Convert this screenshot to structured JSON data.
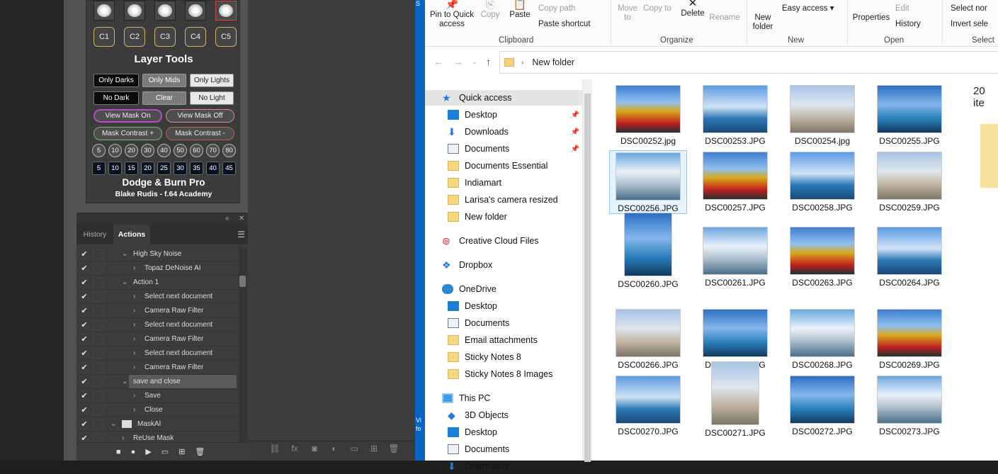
{
  "photoshop": {
    "swatches": [
      "brush-1",
      "brush-2",
      "brush-3",
      "brush-4",
      "brush-5"
    ],
    "channel_buttons": [
      "C1",
      "C2",
      "C3",
      "C4",
      "C5"
    ],
    "layer_tools_title": "Layer Tools",
    "row1": [
      "Only Darks",
      "Only Mids",
      "Only Lights"
    ],
    "row2": [
      "No Dark",
      "Clear",
      "No Light"
    ],
    "row3": [
      "View Mask On",
      "View Mask Off"
    ],
    "row4": [
      "Mask Contrast +",
      "Mask Contrast -"
    ],
    "num_row_1": [
      "5",
      "10",
      "20",
      "30",
      "40",
      "50",
      "60",
      "70",
      "80"
    ],
    "num_row_2": [
      "5",
      "10",
      "15",
      "20",
      "25",
      "30",
      "35",
      "40",
      "45"
    ],
    "panel_title": "Dodge & Burn Pro",
    "panel_subtitle": "Blake Rudis - f.64 Academy",
    "tabs": [
      "History",
      "Actions"
    ],
    "actions": [
      {
        "label": "High Sky Noise",
        "level": 1,
        "open": true
      },
      {
        "label": "Topaz DeNoise AI",
        "level": 2,
        "open": false
      },
      {
        "label": "Action 1",
        "level": 1,
        "open": true
      },
      {
        "label": "Select next document",
        "level": 2,
        "open": false
      },
      {
        "label": "Camera Raw Filter",
        "level": 2,
        "open": false
      },
      {
        "label": "Select next document",
        "level": 2,
        "open": false
      },
      {
        "label": "Camera Raw Filter",
        "level": 2,
        "open": false
      },
      {
        "label": "Select next document",
        "level": 2,
        "open": false
      },
      {
        "label": "Camera Raw Filter",
        "level": 2,
        "open": false
      },
      {
        "label": "save and close",
        "level": 1,
        "open": true,
        "highlight": true
      },
      {
        "label": "Save",
        "level": 2,
        "open": false
      },
      {
        "label": "Close",
        "level": 2,
        "open": false
      },
      {
        "label": "MaskAI",
        "level": 0,
        "open": true,
        "folder": true
      },
      {
        "label": "ReUse Mask",
        "level": 1,
        "open": false
      }
    ]
  },
  "explorer": {
    "ribbon": {
      "pin_label": "Pin to Quick access",
      "copy": "Copy",
      "paste": "Paste",
      "copy_path": "Copy path",
      "paste_shortcut": "Paste shortcut",
      "move_to": "Move to",
      "copy_to": "Copy to",
      "delete": "Delete",
      "rename": "Rename",
      "new_folder": "New folder",
      "easy_access": "Easy access",
      "properties": "Properties",
      "edit": "Edit",
      "history": "History",
      "select_none": "Select nor",
      "invert_selection": "Invert sele",
      "groups": [
        "Clipboard",
        "Organize",
        "New",
        "Open",
        "Select"
      ]
    },
    "address": "New folder",
    "nav": [
      {
        "label": "Quick access",
        "icon": "star-icon",
        "indent": 0,
        "selected": true
      },
      {
        "label": "Desktop",
        "icon": "desktop-icon",
        "indent": 1,
        "pinned": true
      },
      {
        "label": "Downloads",
        "icon": "downloads-icon",
        "indent": 1,
        "pinned": true
      },
      {
        "label": "Documents",
        "icon": "documents-icon",
        "indent": 1,
        "pinned": true
      },
      {
        "label": "Documents Essential",
        "icon": "folder-icon",
        "indent": 1
      },
      {
        "label": "Indiamart",
        "icon": "folder-icon",
        "indent": 1
      },
      {
        "label": "Larisa's camera resized",
        "icon": "folder-icon",
        "indent": 1
      },
      {
        "label": "New folder",
        "icon": "folder-icon",
        "indent": 1
      },
      {
        "label": "Creative Cloud Files",
        "icon": "creative-cloud-icon",
        "indent": 0,
        "gap": true
      },
      {
        "label": "Dropbox",
        "icon": "dropbox-icon",
        "indent": 0,
        "gap": true
      },
      {
        "label": "OneDrive",
        "icon": "onedrive-icon",
        "indent": 0,
        "gap": true
      },
      {
        "label": "Desktop",
        "icon": "desktop-icon",
        "indent": 1
      },
      {
        "label": "Documents",
        "icon": "documents-icon",
        "indent": 1
      },
      {
        "label": "Email attachments",
        "icon": "folder-icon",
        "indent": 1
      },
      {
        "label": "Sticky Notes 8",
        "icon": "folder-icon",
        "indent": 1
      },
      {
        "label": "Sticky Notes 8 Images",
        "icon": "folder-icon",
        "indent": 1
      },
      {
        "label": "This PC",
        "icon": "pc-icon",
        "indent": 0,
        "gap": true
      },
      {
        "label": "3D Objects",
        "icon": "3d-objects-icon",
        "indent": 1
      },
      {
        "label": "Desktop",
        "icon": "desktop-icon",
        "indent": 1
      },
      {
        "label": "Documents",
        "icon": "documents-icon",
        "indent": 1
      },
      {
        "label": "Downloads",
        "icon": "downloads-icon",
        "indent": 1
      }
    ],
    "item_count": "20 ite",
    "files": [
      "DSC00252.jpg",
      "DSC00253.JPG",
      "DSC00254.jpg",
      "DSC00255.JPG",
      "DSC00256.JPG",
      "DSC00257.JPG",
      "DSC00258.JPG",
      "DSC00259.JPG",
      "DSC00260.JPG",
      "DSC00261.JPG",
      "DSC00263.JPG",
      "DSC00264.JPG",
      "DSC00266.JPG",
      "DSC00267.JPG",
      "DSC00268.JPG",
      "DSC00269.JPG",
      "DSC00270.JPG",
      "DSC00271.JPG",
      "DSC00272.JPG",
      "DSC00273.JPG"
    ],
    "selected_file": "DSC00256.JPG"
  }
}
